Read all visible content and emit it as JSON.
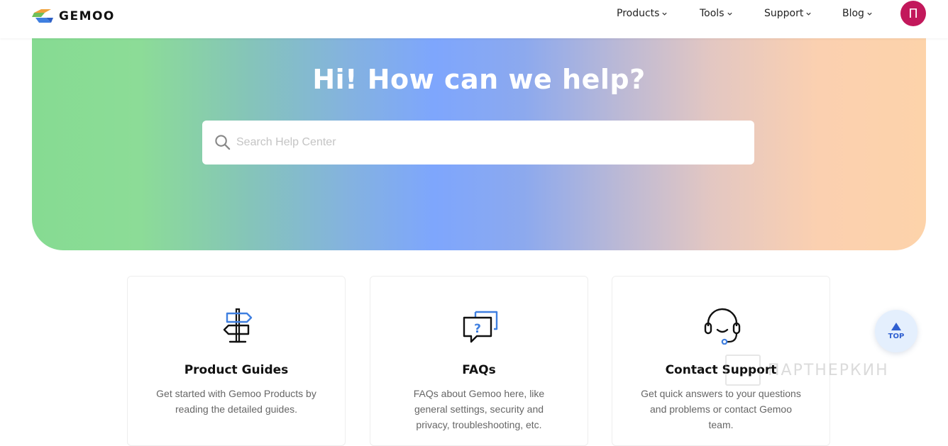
{
  "header": {
    "logo_text": "GEMOO",
    "nav": [
      {
        "label": "Products",
        "icon": "chevron-down-icon"
      },
      {
        "label": "Tools",
        "icon": "chevron-down-icon"
      },
      {
        "label": "Support",
        "icon": "chevron-down-icon"
      },
      {
        "label": "Blog",
        "icon": "chevron-down-icon"
      }
    ],
    "avatar_initial": "П",
    "avatar_color": "#c2185b"
  },
  "hero": {
    "title": "Hi! How can we help?",
    "search": {
      "placeholder": "Search Help Center",
      "value": "",
      "icon": "search-icon"
    }
  },
  "cards": [
    {
      "icon": "signpost-icon",
      "title": "Product Guides",
      "description": "Get started with Gemoo Products by reading the detailed guides."
    },
    {
      "icon": "faq-chat-icon",
      "title": "FAQs",
      "description": "FAQs about Gemoo here, like general settings, security and privacy, troubleshooting, etc."
    },
    {
      "icon": "headset-icon",
      "title": "Contact Support",
      "description": "Get quick answers to your questions and problems or contact Gemoo team."
    }
  ],
  "top_button": {
    "label": "TOP",
    "icon": "arrow-up-icon"
  },
  "watermark": {
    "text": "ПАРТНЕРКИН"
  },
  "colors": {
    "accent": "#2f5fd0",
    "avatar": "#c2185b",
    "hero_green": "#86db92",
    "hero_blue": "#7ea6fd",
    "hero_peach": "#fdd3aa"
  }
}
